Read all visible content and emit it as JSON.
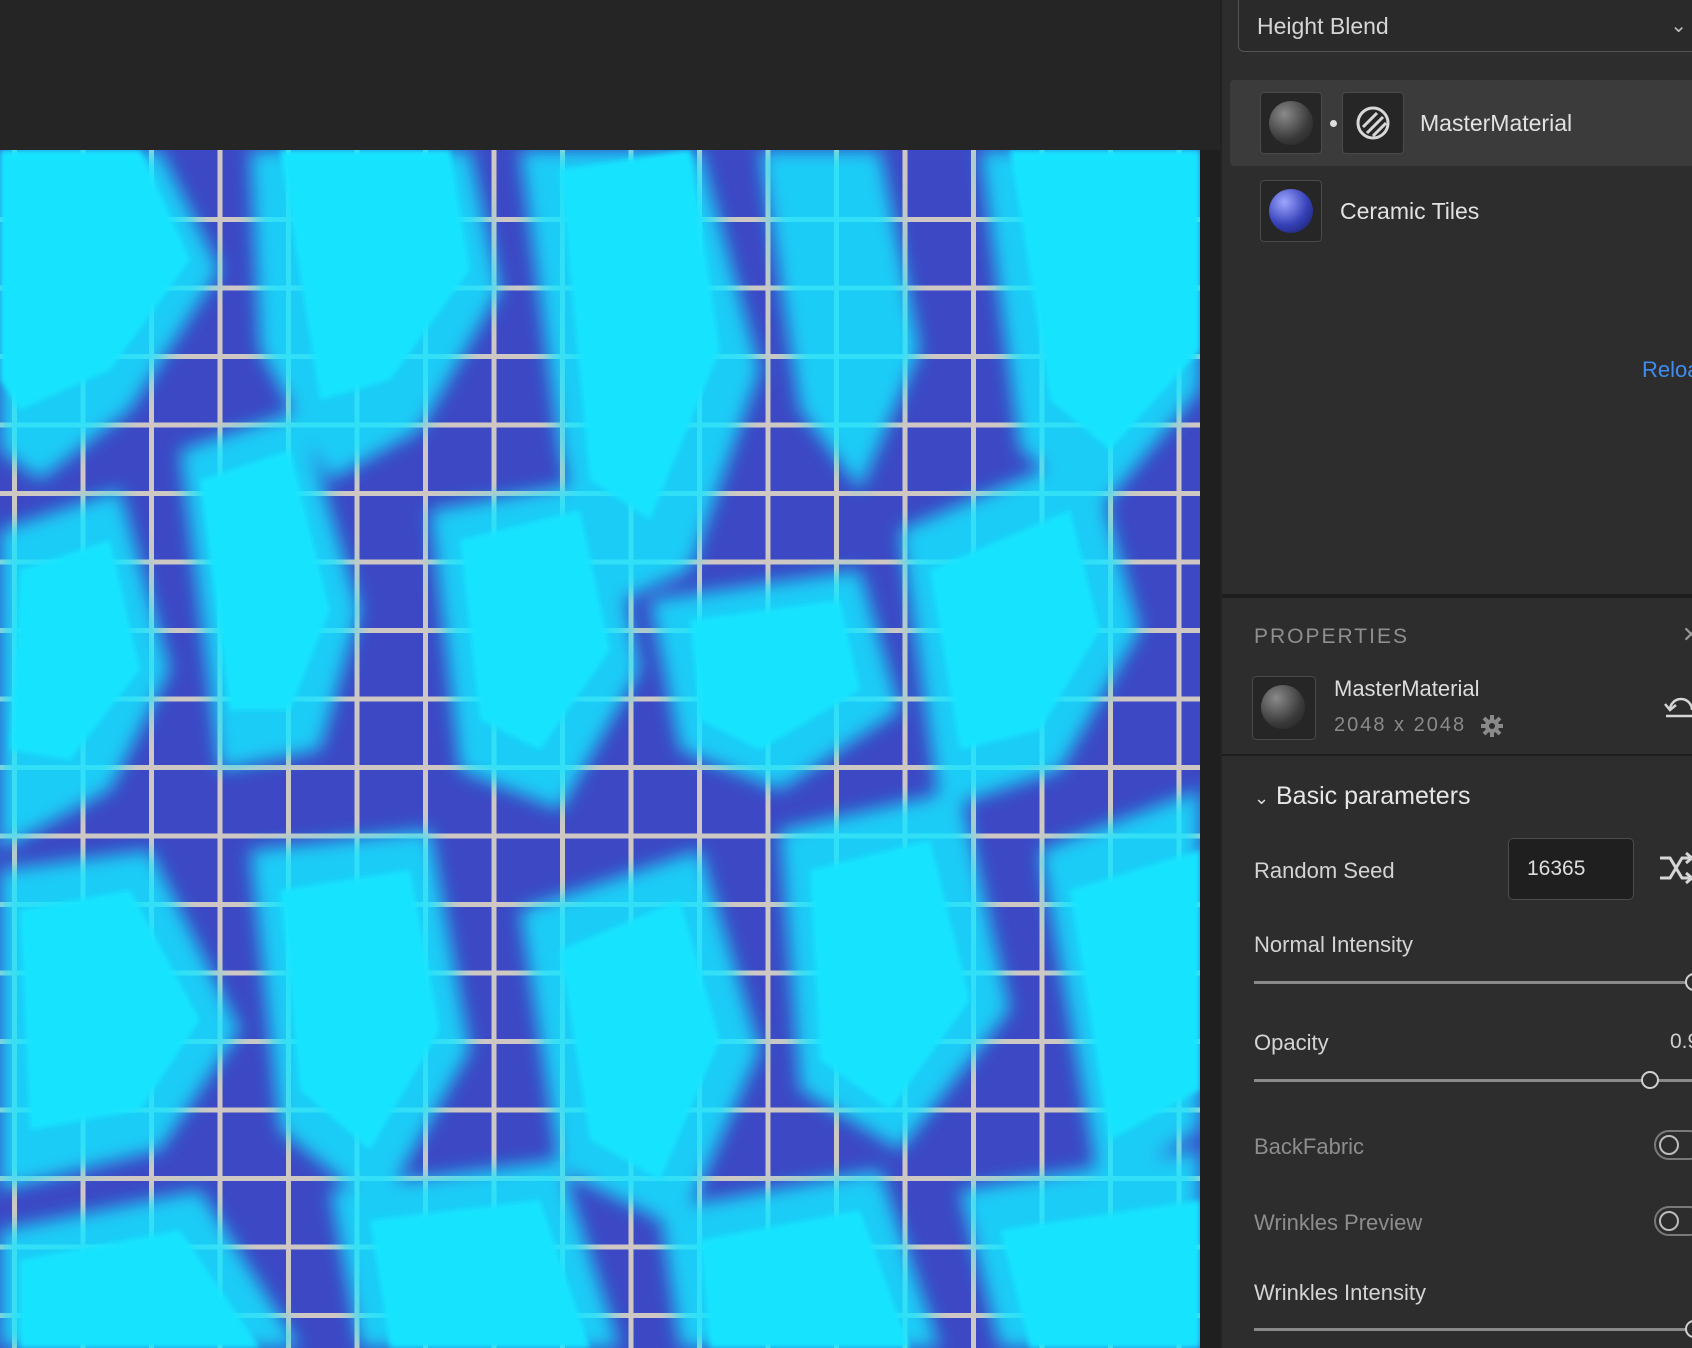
{
  "layers_panel": {
    "blend_mode": "Height Blend",
    "layers": [
      {
        "name": "MasterMaterial",
        "selected": true
      },
      {
        "name": "Ceramic Tiles",
        "selected": false
      }
    ],
    "reload_label": "Reloa"
  },
  "properties": {
    "title": "PROPERTIES",
    "material_name": "MasterMaterial",
    "resolution": "2048 x 2048",
    "section_title": "Basic parameters",
    "random_seed": {
      "label": "Random Seed",
      "value": "16365"
    },
    "normal_intensity": {
      "label": "Normal Intensity",
      "value": 1.0
    },
    "opacity": {
      "label": "Opacity",
      "value_text": "0.9",
      "value": 0.9
    },
    "back_fabric": {
      "label": "BackFabric",
      "on": false
    },
    "wrinkles_preview": {
      "label": "Wrinkles Preview",
      "on": false
    },
    "wrinkles_intensity": {
      "label": "Wrinkles Intensity",
      "value": 1.0
    }
  },
  "colors": {
    "tile": "#3c48c4",
    "grout": "#cfc7c4",
    "paint": "#12e4ff",
    "accent_link": "#3f8cf0"
  }
}
